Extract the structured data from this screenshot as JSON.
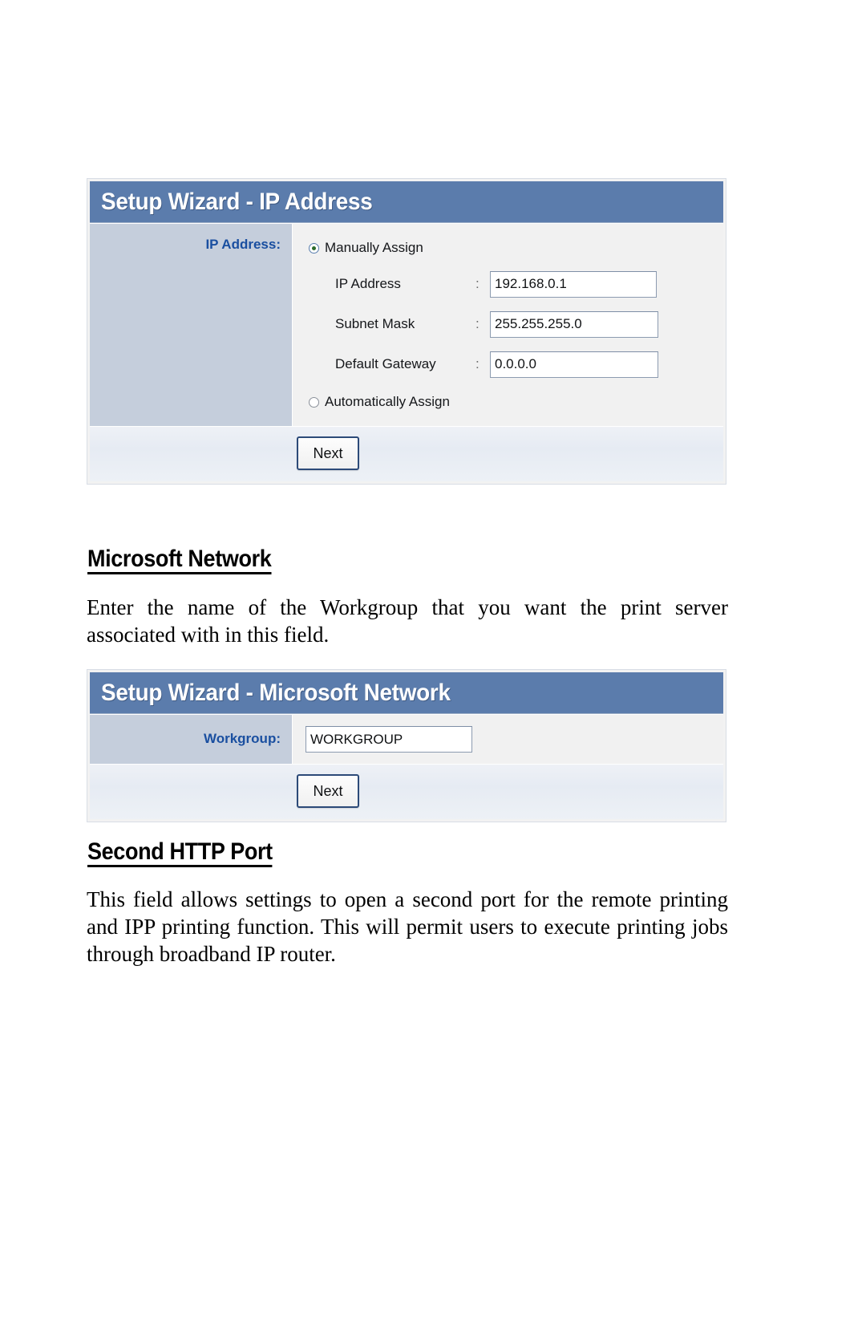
{
  "document": {
    "panel_ip": {
      "title": "Setup Wizard - IP Address",
      "section_label": "IP Address:",
      "radio_manual": "Manually Assign",
      "radio_auto": "Automatically Assign",
      "separator": ":",
      "fields": [
        {
          "label": "IP Address",
          "value": "192.168.0.1"
        },
        {
          "label": "Subnet Mask",
          "value": "255.255.255.0"
        },
        {
          "label": "Default Gateway",
          "value": "0.0.0.0"
        }
      ],
      "next_button": "Next"
    },
    "section_microsoft_network": {
      "heading": "Microsoft Network",
      "paragraph": "Enter the name of the Workgroup that you want the print server associated with in this field."
    },
    "panel_msnet": {
      "title": "Setup Wizard - Microsoft Network",
      "workgroup_label": "Workgroup:",
      "workgroup_value": "WORKGROUP",
      "next_button": "Next"
    },
    "section_second_http_port": {
      "heading": "Second HTTP Port",
      "paragraph": "This field allows settings to open a second port for the remote printing and IPP printing function. This will permit users to execute printing jobs through broadband IP router."
    },
    "colors": {
      "titlebar_blue": "#5b7cac",
      "label_column": "#c5cedc",
      "label_text_blue": "#1a4fa0",
      "panel_background": "#f1f1f1",
      "button_border": "#2c4a78",
      "radio_dot": "#2b6b2b"
    }
  }
}
